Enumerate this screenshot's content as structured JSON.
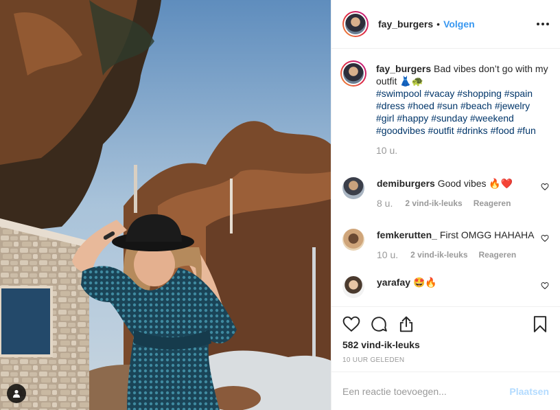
{
  "header": {
    "username": "fay_burgers",
    "separator": "•",
    "follow_label": "Volgen",
    "more_icon": "more-horizontal-icon"
  },
  "caption": {
    "username": "fay_burgers",
    "text": "Bad vibes don’t go with my outfit 👗🐢",
    "hashtags": [
      "#swimpool",
      "#vacay",
      "#shopping",
      "#spain",
      "#dress",
      "#hoed",
      "#sun",
      "#beach",
      "#jewelry",
      "#girl",
      "#happy",
      "#sunday",
      "#weekend",
      "#goodvibes",
      "#outfit",
      "#drinks",
      "#food",
      "#fun"
    ],
    "time": "10 u."
  },
  "comments": [
    {
      "username": "demiburgers",
      "text": "Good vibes 🔥❤️",
      "time": "8 u.",
      "likes": "2 vind-ik-leuks",
      "reply": "Reageren"
    },
    {
      "username": "femkerutten_",
      "text": "First OMGG HAHAHA",
      "time": "10 u.",
      "likes": "2 vind-ik-leuks",
      "reply": "Reageren"
    },
    {
      "username": "yarafay",
      "text": "🤩🔥"
    }
  ],
  "actions": {
    "like_count": "582 vind-ik-leuks",
    "posted": "10 UUR GELEDEN",
    "icons": [
      "heart-icon",
      "comment-icon",
      "share-icon",
      "bookmark-icon"
    ]
  },
  "add_comment": {
    "placeholder": "Een reactie toevoegen...",
    "post_label": "Plaatsen"
  },
  "colors": {
    "link_blue": "#3897f0",
    "hashtag": "#003569",
    "muted": "#999999",
    "post_disabled": "#b3dbff"
  }
}
